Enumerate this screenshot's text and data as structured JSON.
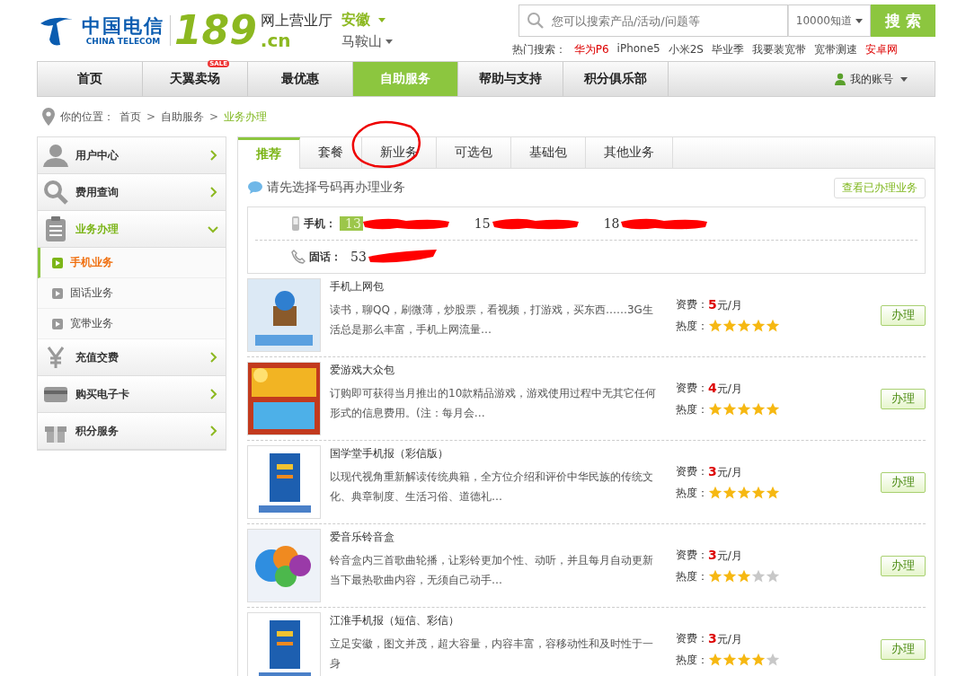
{
  "header": {
    "logo_cn": "中国电信",
    "logo_en": "CHINA TELECOM",
    "brand_number": "189",
    "brand_domain": ".cn",
    "site_name": "网上营业厅",
    "province": "安徽",
    "city": "马鞍山",
    "search": {
      "placeholder": "您可以搜索产品/活动/问题等",
      "scope": "10000知道",
      "button": "搜 索"
    },
    "hot_label": "热门搜索：",
    "hot_links": [
      {
        "text": "华为P6",
        "highlight": true
      },
      {
        "text": "iPhone5",
        "highlight": false
      },
      {
        "text": "小米2S",
        "highlight": false
      },
      {
        "text": "毕业季",
        "highlight": false
      },
      {
        "text": "我要装宽带",
        "highlight": false
      },
      {
        "text": "宽带测速",
        "highlight": false
      },
      {
        "text": "安卓网",
        "highlight": true
      }
    ]
  },
  "nav": {
    "items": [
      {
        "label": "首页",
        "selected": false
      },
      {
        "label": "天翼卖场",
        "selected": false,
        "badge": "SALE"
      },
      {
        "label": "最优惠",
        "selected": false
      },
      {
        "label": "自助服务",
        "selected": true
      },
      {
        "label": "帮助与支持",
        "selected": false
      },
      {
        "label": "积分俱乐部",
        "selected": false
      }
    ],
    "account": "我的账号"
  },
  "breadcrumb": {
    "label": "你的位置：",
    "items": [
      {
        "kind": "link",
        "text": "首页",
        "current": false
      },
      {
        "kind": "separator",
        "text": ">"
      },
      {
        "kind": "link",
        "text": "自助服务",
        "current": false
      },
      {
        "kind": "separator",
        "text": ">"
      },
      {
        "kind": "link",
        "text": "业务办理",
        "current": true
      }
    ]
  },
  "sidebar": {
    "items": [
      {
        "label": "用户中心",
        "expanded": false
      },
      {
        "label": "费用查询",
        "expanded": false
      },
      {
        "label": "业务办理",
        "expanded": true,
        "children": [
          {
            "label": "手机业务",
            "selected": true
          },
          {
            "label": "固话业务",
            "selected": false
          },
          {
            "label": "宽带业务",
            "selected": false
          }
        ]
      },
      {
        "label": "充值交费",
        "expanded": false
      },
      {
        "label": "购买电子卡",
        "expanded": false
      },
      {
        "label": "积分服务",
        "expanded": false
      }
    ]
  },
  "tabs": [
    {
      "label": "推荐",
      "selected": true
    },
    {
      "label": "套餐",
      "selected": false
    },
    {
      "label": "新业务",
      "selected": false
    },
    {
      "label": "可选包",
      "selected": false
    },
    {
      "label": "基础包",
      "selected": false
    },
    {
      "label": "其他业务",
      "selected": false
    }
  ],
  "notice": "请先选择号码再办理业务",
  "view_link": "查看已办理业务",
  "numbers": {
    "mobile_label": "手机：",
    "mobile": [
      {
        "number": "13",
        "selected": true
      },
      {
        "number": "15",
        "selected": false
      },
      {
        "number": "18",
        "selected": false
      }
    ],
    "landline_label": "固话：",
    "landline": [
      {
        "number": "53",
        "selected": false
      }
    ]
  },
  "products": [
    {
      "title": "手机上网包",
      "description": "读书，聊QQ，刷微薄，炒股票，看视频，打游戏，买东西……3G生活总是那么丰富，手机上网流量…",
      "price_label": "资费：",
      "price": "5",
      "unit": "元/月",
      "heat_label": "热度：",
      "stars": 5,
      "button": "办理"
    },
    {
      "title": "爱游戏大众包",
      "description": "订购即可获得当月推出的10款精品游戏，游戏使用过程中无其它任何形式的信息费用。(注：每月会…",
      "price_label": "资费：",
      "price": "4",
      "unit": "元/月",
      "heat_label": "热度：",
      "stars": 5,
      "button": "办理"
    },
    {
      "title": "国学堂手机报（彩信版）",
      "description": "以现代视角重新解读传统典籍，全方位介绍和评价中华民族的传统文化、典章制度、生活习俗、道德礼…",
      "price_label": "资费：",
      "price": "3",
      "unit": "元/月",
      "heat_label": "热度：",
      "stars": 5,
      "button": "办理"
    },
    {
      "title": "爱音乐铃音盒",
      "description": "铃音盒内三首歌曲轮播，让彩铃更加个性、动听，并且每月自动更新当下最热歌曲内容，无须自己动手…",
      "price_label": "资费：",
      "price": "3",
      "unit": "元/月",
      "heat_label": "热度：",
      "stars": 3,
      "button": "办理"
    },
    {
      "title": "江淮手机报（短信、彩信）",
      "description": "立足安徽，图文并茂，超大容量，内容丰富，容移动性和及时性于一身",
      "price_label": "资费：",
      "price": "3",
      "unit": "元/月",
      "heat_label": "热度：",
      "stars": 4,
      "button": "办理"
    }
  ]
}
